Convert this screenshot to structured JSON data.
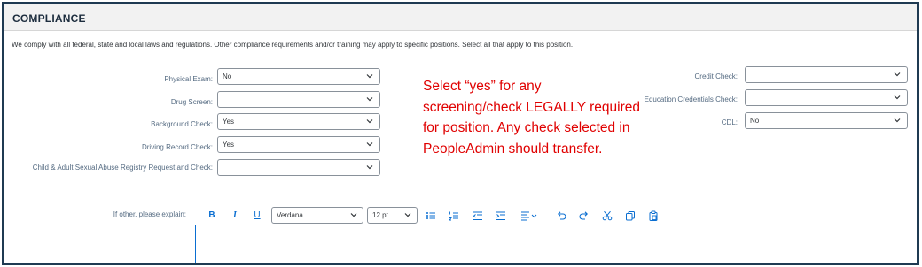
{
  "section": {
    "title": "COMPLIANCE",
    "description": "We comply with all federal, state and local laws and regulations. Other compliance requirements and/or training may apply to specific positions. Select all that apply to this position."
  },
  "fields_left": [
    {
      "label": "Physical Exam:",
      "value": "No"
    },
    {
      "label": "Drug Screen:",
      "value": ""
    },
    {
      "label": "Background Check:",
      "value": "Yes"
    },
    {
      "label": "Driving Record Check:",
      "value": "Yes"
    },
    {
      "label": "Child & Adult Sexual Abuse Registry Request and Check:",
      "value": ""
    }
  ],
  "fields_right": [
    {
      "label": "Credit Check:",
      "value": ""
    },
    {
      "label": "Education Credentials Check:",
      "value": ""
    },
    {
      "label": "CDL:",
      "value": "No"
    }
  ],
  "annotation": {
    "text": "Select “yes” for any screening/check LEGALLY required for position. Any check selected in PeopleAdmin should transfer.",
    "color": "#e00000"
  },
  "explain": {
    "label": "If other, please explain:",
    "font_family_value": "Verdana",
    "font_size_value": "12 pt",
    "bold_label": "B",
    "italic_label": "I",
    "underline_label": "U"
  },
  "colors": {
    "accent": "#0a6ed1",
    "frame": "#1f3a52"
  }
}
